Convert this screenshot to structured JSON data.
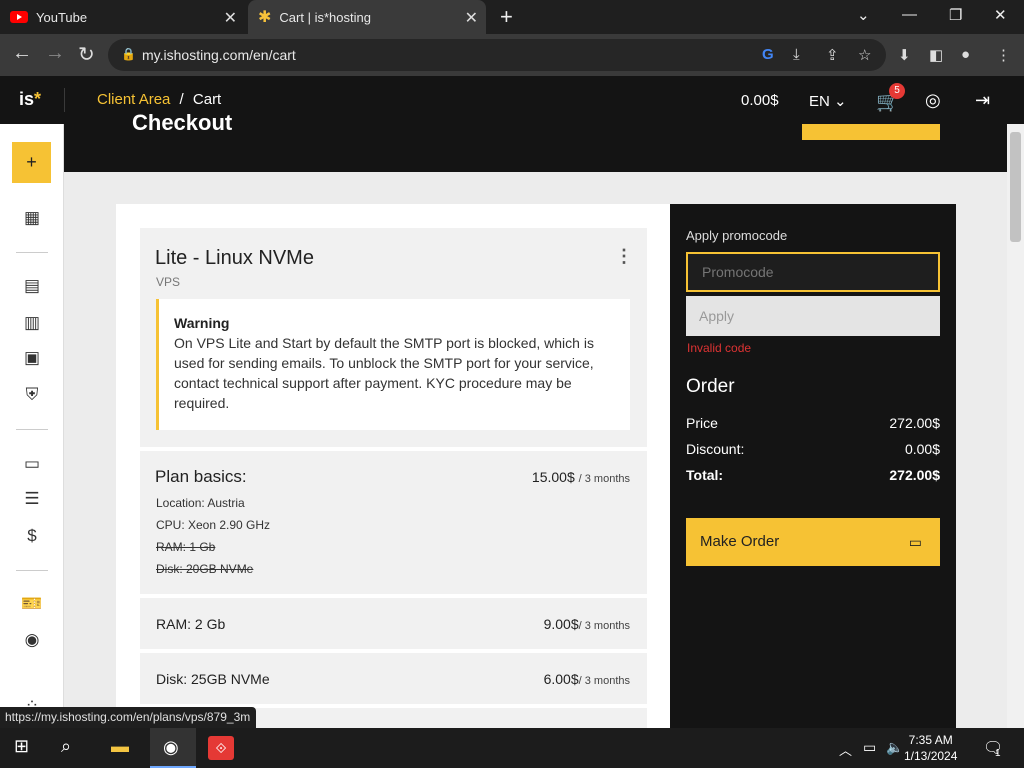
{
  "browser": {
    "tabs": [
      {
        "title": "YouTube",
        "icon": "youtube-icon"
      },
      {
        "title": "Cart | is*hosting",
        "icon": "ishosting-icon"
      }
    ],
    "url": "my.ishosting.com/en/cart"
  },
  "header": {
    "logo_text": "is",
    "logo_star": "*",
    "breadcrumb_client": "Client Area",
    "breadcrumb_sep": "/",
    "breadcrumb_page": "Cart",
    "balance": "0.00$",
    "language": "EN",
    "cart_count": "5"
  },
  "page": {
    "heading": "Checkout"
  },
  "product": {
    "title": "Lite - Linux NVMe",
    "type": "VPS",
    "warning_title": "Warning",
    "warning_text": "On VPS Lite and Start by default the SMTP port is blocked, which is used for sending emails. To unblock the SMTP port for your service, contact technical support after payment. KYC procedure may be required.",
    "plan_title": "Plan basics:",
    "plan_price": "15.00$",
    "plan_period": "/ 3 months",
    "plan_location": "Location: Austria",
    "plan_cpu": "CPU: Xeon 2.90 GHz",
    "plan_ram_old": "RAM: 1 Gb",
    "plan_disk_old": "Disk: 20GB NVMe",
    "ram_label": "RAM:",
    "ram_value": "2 Gb",
    "ram_price": "9.00$",
    "ram_period": "/ 3 months",
    "disk_label": "Disk:",
    "disk_value": "25GB NVMe",
    "disk_price": "6.00$",
    "disk_period": "/ 3 months"
  },
  "order": {
    "promo_label": "Apply promocode",
    "promo_placeholder": "Promocode",
    "apply_label": "Apply",
    "invalid_text": "Invalid code",
    "order_title": "Order",
    "price_label": "Price",
    "price_value": "272.00$",
    "discount_label": "Discount:",
    "discount_value": "0.00$",
    "total_label": "Total:",
    "total_value": "272.00$",
    "make_order_label": "Make Order"
  },
  "status_url": "https://my.ishosting.com/en/plans/vps/879_3m",
  "taskbar": {
    "time": "7:35 AM",
    "date": "1/13/2024",
    "notification_count": "1"
  },
  "colors": {
    "accent": "#f6c234",
    "dark": "#141414",
    "error": "#dd3333"
  }
}
